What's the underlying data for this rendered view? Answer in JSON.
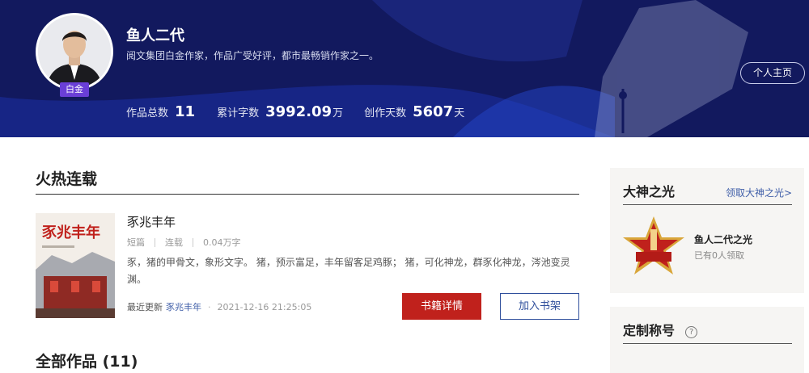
{
  "author": {
    "name": "鱼人二代",
    "badge": "白金",
    "description": "阅文集团白金作家，作品广受好评，都市最畅销作家之一。",
    "home_button": "个人主页"
  },
  "stats": [
    {
      "label": "作品总数",
      "value": "11",
      "unit": ""
    },
    {
      "label": "累计字数",
      "value": "3992.09",
      "unit": "万"
    },
    {
      "label": "创作天数",
      "value": "5607",
      "unit": "天"
    }
  ],
  "hot_section": {
    "title": "火热连载",
    "book": {
      "title": "豕兆丰年",
      "meta": [
        "短篇",
        "连载",
        "0.04万字"
      ],
      "description": "豕，猪的甲骨文，象形文字。 猪，预示富足，丰年留客足鸡豚； 猪，可化神龙，群豕化神龙，涔池变灵渊。",
      "update_label": "最近更新",
      "update_chapter": "豕兆丰年",
      "update_dot": "·",
      "update_time": "2021-12-16 21:25:05",
      "detail_button": "书籍详情",
      "shelf_button": "加入书架"
    }
  },
  "all_works_title": "全部作品 (11)",
  "sidebar": {
    "god_light": {
      "title": "大神之光",
      "link": "领取大神之光>",
      "medal_name": "鱼人二代之光",
      "medal_count": "已有0人领取"
    },
    "custom_title": {
      "title": "定制称号",
      "help": "?"
    }
  },
  "colors": {
    "banner": "#12195e",
    "badge": "#6a3fd6",
    "accent_red": "#c0211c",
    "link_blue": "#3f5ea8"
  }
}
